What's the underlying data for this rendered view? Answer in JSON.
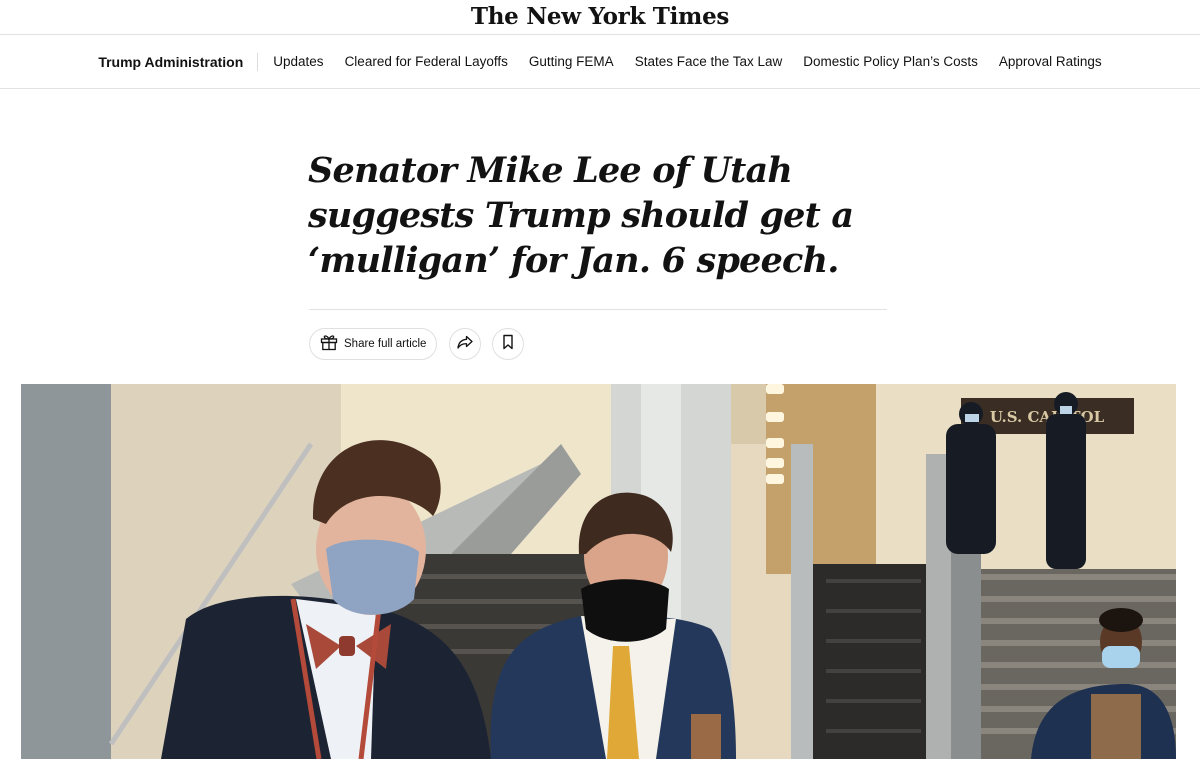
{
  "masthead": {
    "logo_text": "The New York Times"
  },
  "subnav": {
    "title": "Trump Administration",
    "links": [
      "Updates",
      "Cleared for Federal Layoffs",
      "Gutting FEMA",
      "States Face the Tax Law",
      "Domestic Policy Plan’s Costs",
      "Approval Ratings"
    ]
  },
  "article": {
    "headline": "Senator Mike Lee of Utah suggests Trump should get a ‘mulligan’ for Jan. 6 speech."
  },
  "toolbar": {
    "share_full_label": "Share full article",
    "share_icon": "share-arrow-icon",
    "save_icon": "bookmark-icon",
    "gift_icon": "gift-icon"
  },
  "photo": {
    "sign_text": "U.S. CAPITOL"
  },
  "colors": {
    "text": "#121212",
    "divider": "#e2e2e2",
    "button_border": "#dfdfdf"
  }
}
